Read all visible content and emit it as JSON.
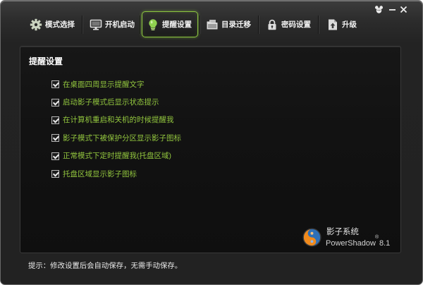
{
  "window": {
    "controls": {
      "menu_icon": "main-menu-icon",
      "minimize_icon": "minimize-icon",
      "close_icon": "close-icon"
    }
  },
  "toolbar": {
    "tabs": [
      {
        "label": "模式选择",
        "icon": "gear-icon",
        "selected": false
      },
      {
        "label": "开机启动",
        "icon": "monitor-icon",
        "selected": false
      },
      {
        "label": "提醒设置",
        "icon": "lightbulb-icon",
        "selected": true
      },
      {
        "label": "目录迁移",
        "icon": "folder-icon",
        "selected": false
      },
      {
        "label": "密码设置",
        "icon": "lock-icon",
        "selected": false
      },
      {
        "label": "升级",
        "icon": "upgrade-icon",
        "selected": false
      }
    ]
  },
  "panel": {
    "title": "提醒设置",
    "options": [
      {
        "label": "在桌面四周显示提醒文字",
        "checked": true
      },
      {
        "label": "启动影子模式后显示状态提示",
        "checked": true
      },
      {
        "label": "在计算机重启和关机的时候提醒我",
        "checked": true
      },
      {
        "label": "影子模式下被保护分区显示影子图标",
        "checked": true
      },
      {
        "label": "正常模式下定时提醒我(托盘区域)",
        "checked": true
      },
      {
        "label": "托盘区域显示影子图标",
        "checked": true
      }
    ]
  },
  "branding": {
    "logo_icon": "powershadow-logo-icon",
    "name_cn": "影子系统",
    "name_en": "PowerShadow",
    "registered_mark": "®",
    "version": "8.1"
  },
  "status_bar": {
    "tip": "提示：修改设置后会自动保存，无需手动保存。"
  },
  "colors": {
    "accent": "#8cc63f",
    "option_text": "#92c63e",
    "title_text": "#ffffff",
    "window_background": "#222222",
    "panel_background": "#121212"
  }
}
